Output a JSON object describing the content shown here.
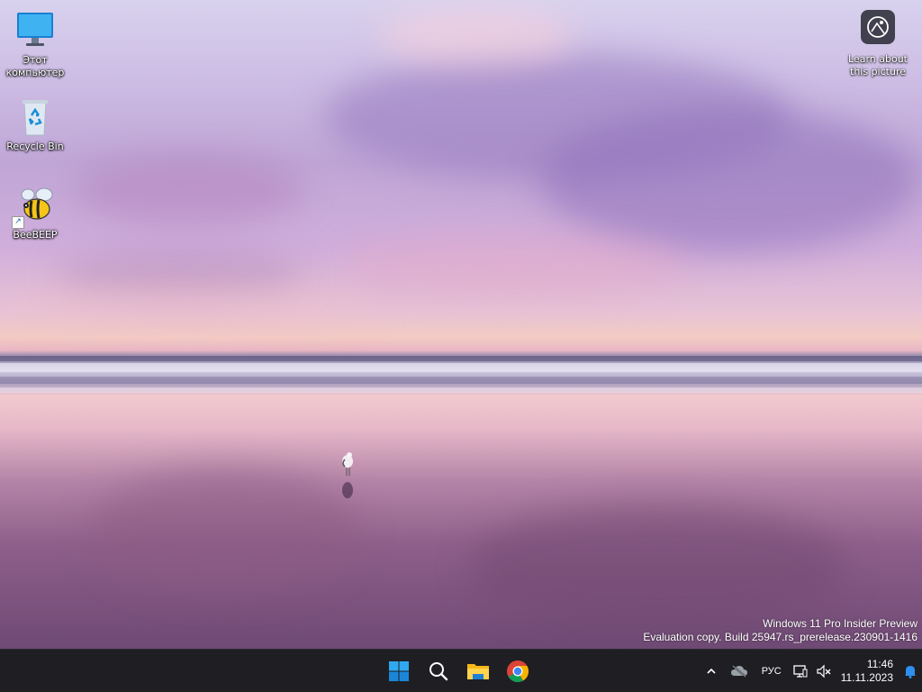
{
  "desktop": {
    "icons": [
      {
        "label": "Этот компьютер",
        "icon": "monitor-icon"
      },
      {
        "label": "Recycle Bin",
        "icon": "recycle-bin-icon"
      },
      {
        "label": "BeeBEEP",
        "icon": "bee-icon"
      }
    ],
    "spotlight": {
      "label": "Learn about this picture",
      "icon": "camera-icon"
    },
    "watermark": {
      "line1": "Windows 11 Pro Insider Preview",
      "line2": "Evaluation copy. Build 25947.rs_prerelease.230901-1416"
    }
  },
  "taskbar": {
    "apps": [
      {
        "name": "Start",
        "icon": "windows-logo-icon"
      },
      {
        "name": "Search",
        "icon": "search-icon"
      },
      {
        "name": "File Explorer",
        "icon": "folder-icon"
      },
      {
        "name": "Google Chrome",
        "icon": "chrome-icon"
      }
    ],
    "tray": {
      "language": "РУС",
      "time": "11:46",
      "date": "11.11.2023"
    },
    "colors": {
      "background": "#1f1f23",
      "accent": "#0078d4"
    }
  }
}
